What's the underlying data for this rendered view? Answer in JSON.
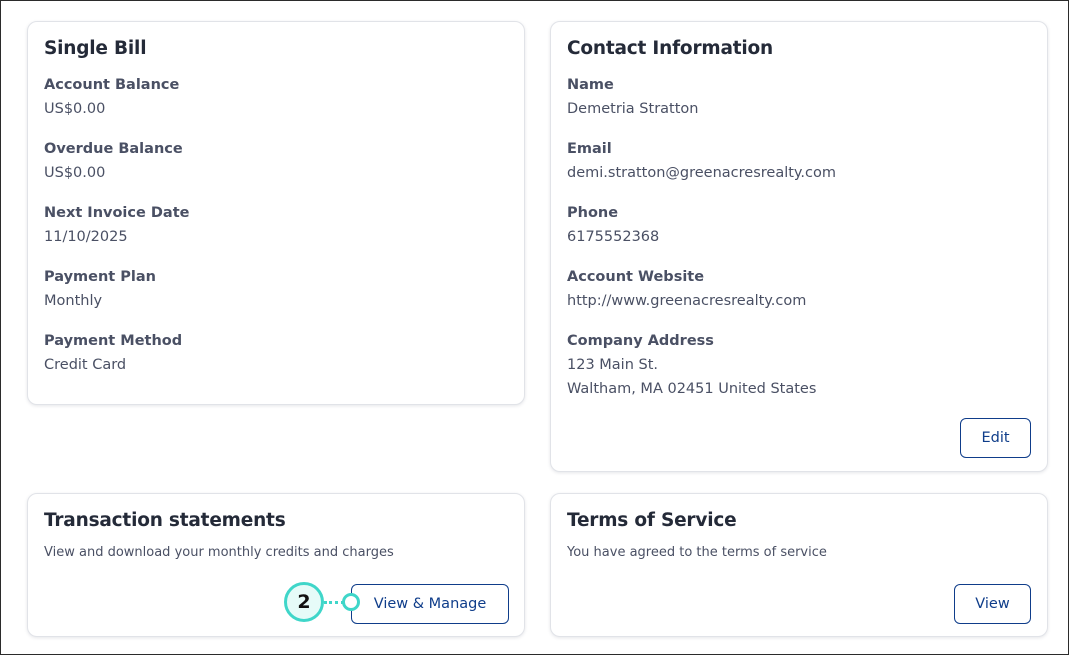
{
  "single_bill": {
    "title": "Single Bill",
    "fields": [
      {
        "label": "Account Balance",
        "value": "US$0.00"
      },
      {
        "label": "Overdue Balance",
        "value": "US$0.00"
      },
      {
        "label": "Next Invoice Date",
        "value": "11/10/2025"
      },
      {
        "label": "Payment Plan",
        "value": "Monthly"
      },
      {
        "label": "Payment Method",
        "value": "Credit Card"
      }
    ]
  },
  "contact": {
    "title": "Contact Information",
    "name_label": "Name",
    "name_value": "Demetria Stratton",
    "email_label": "Email",
    "email_value": "demi.stratton@greenacresrealty.com",
    "phone_label": "Phone",
    "phone_value": "6175552368",
    "website_label": "Account Website",
    "website_value": "http://www.greenacresrealty.com",
    "address_label": "Company Address",
    "address_line1": "123 Main St.",
    "address_line2": "Waltham, MA 02451 United States",
    "edit_label": "Edit"
  },
  "transactions": {
    "title": "Transaction statements",
    "description": "View and download your monthly credits and charges",
    "button_label": "View & Manage"
  },
  "terms": {
    "title": "Terms of Service",
    "description": "You have agreed to the terms of service",
    "button_label": "View"
  },
  "callout": {
    "number": "2",
    "color": "#3fd6c9"
  },
  "colors": {
    "button_text": "#0f3d8a",
    "heading": "#242a38",
    "body_text": "#4a5064"
  }
}
